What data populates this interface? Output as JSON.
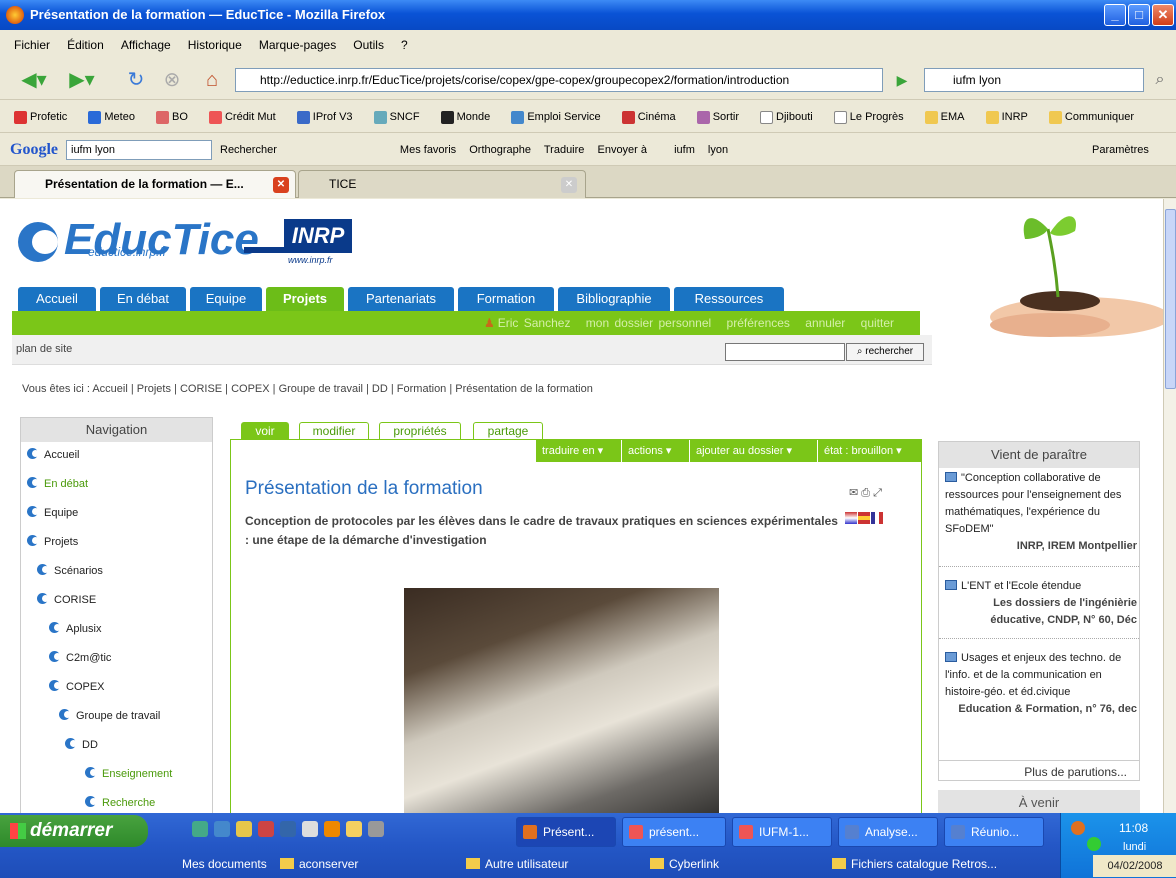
{
  "window": {
    "title": "Présentation de la formation — EducTice - Mozilla Firefox"
  },
  "menu": [
    "Fichier",
    "Édition",
    "Affichage",
    "Historique",
    "Marque-pages",
    "Outils",
    "?"
  ],
  "nav": {
    "url": "http://eductice.inrp.fr/EducTice/projets/corise/copex/gpe-copex/groupecopex2/formation/introduction",
    "search": "iufm lyon"
  },
  "bookmarks": [
    "Profetic",
    "Meteo",
    "BO",
    "Crédit Mut",
    "IProf V3",
    "SNCF",
    "Monde",
    "Emploi Service",
    "Cinéma",
    "Sortir",
    "Djibouti",
    "Le Progrès",
    "EMA",
    "INRP",
    "Communiquer"
  ],
  "google": {
    "logo": "Google",
    "query": "iufm lyon",
    "items": [
      "Rechercher",
      "Mes favoris",
      "Orthographe",
      "Traduire",
      "Envoyer à",
      "iufm",
      "lyon"
    ],
    "settings": "Paramètres"
  },
  "tabs": [
    "Présentation de la formation — E...",
    "TICE"
  ],
  "site": {
    "logo": "EducTice",
    "logo_url": "eductice.inrp.fr",
    "inrp": "INRP",
    "inrp_url": "www.inrp.fr",
    "mainnav": [
      "Accueil",
      "En débat",
      "Equipe",
      "Projets",
      "Partenariats",
      "Formation",
      "Bibliographie",
      "Ressources"
    ],
    "user": [
      "Eric Sanchez",
      "mon dossier personnel",
      "préférences",
      "annuler",
      "quitter"
    ],
    "plan": "plan de site",
    "search_btn": "rechercher",
    "breadcrumb": "Vous êtes ici : Accueil | Projets | CORISE | COPEX | Groupe de travail | DD | Formation | Présentation de la formation"
  },
  "leftnav": {
    "title": "Navigation",
    "items": [
      "Accueil",
      "En débat",
      "Equipe",
      "Projets",
      "Scénarios",
      "CORISE",
      "Aplusix",
      "C2m@tic",
      "COPEX",
      "Groupe de travail",
      "DD",
      "Enseignement",
      "Recherche"
    ]
  },
  "content": {
    "tabs": [
      "voir",
      "modifier",
      "propriétés",
      "partage"
    ],
    "actions": [
      "traduire en",
      "actions",
      "ajouter au dossier",
      "état : brouillon"
    ],
    "title": "Présentation de la formation",
    "subtitle": "Conception de protocoles par les élèves dans le cadre de travaux pratiques en sciences expérimentales : une étape de la démarche d'investigation"
  },
  "right": {
    "title": "Vient de paraître",
    "items": [
      {
        "text": "\"Conception collaborative de ressources pour l'enseignement des mathématiques, l'expérience du SFoDEM\"",
        "source": "INRP, IREM Montpellier"
      },
      {
        "text": "L'ENT et l'Ecole étendue",
        "source": "Les dossiers de l'ingénièrie éducative, CNDP, N° 60, Déc"
      },
      {
        "text": "Usages et enjeux des techno. de l'info. et de la communication en histoire-géo. et éd.civique",
        "source": "Education & Formation, n° 76, dec"
      }
    ],
    "more": "Plus de parutions...",
    "next": "À venir"
  },
  "taskbar": {
    "start": "démarrer",
    "tasks": [
      "Présent...",
      "présent...",
      "IUFM-1...",
      "Analyse...",
      "Réunio..."
    ],
    "folders": [
      "Mes documents",
      "aconserver",
      "Autre utilisateur",
      "Cyberlink",
      "Fichiers catalogue Retros..."
    ],
    "time": "11:08",
    "day": "lundi",
    "date": "04/02/2008"
  }
}
